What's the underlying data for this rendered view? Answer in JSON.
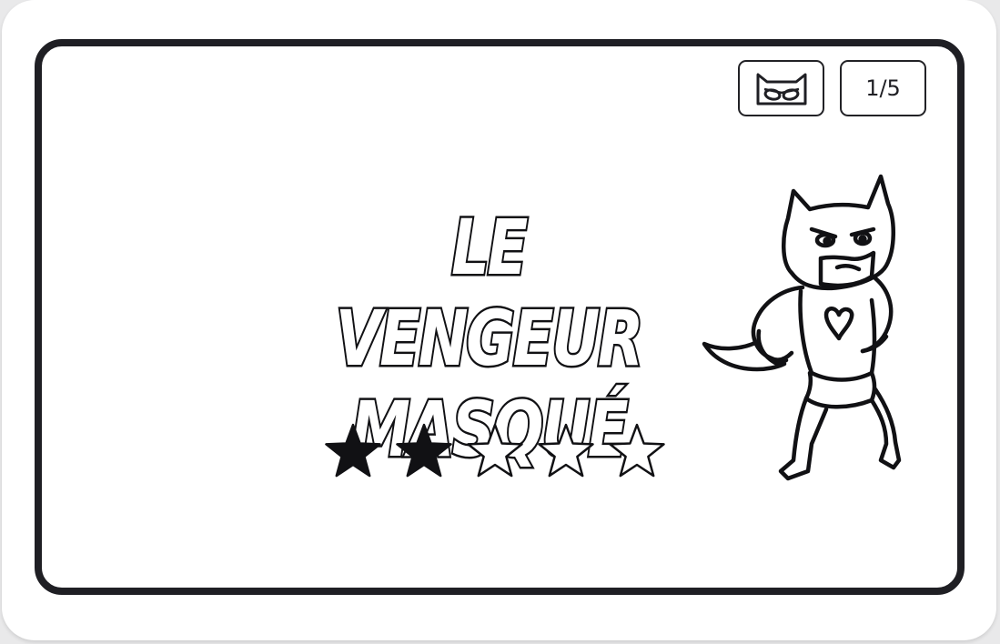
{
  "card": {
    "title_line1": "LE VENGEUR",
    "title_line2": "MASQUÉ",
    "counter": "1/5",
    "category_icon": "mask-icon",
    "character_icon": "masked-hero-illustration"
  },
  "rating": {
    "filled": 2,
    "max": 5
  },
  "colors": {
    "ink": "#1f1f24",
    "paper": "#ffffff"
  }
}
